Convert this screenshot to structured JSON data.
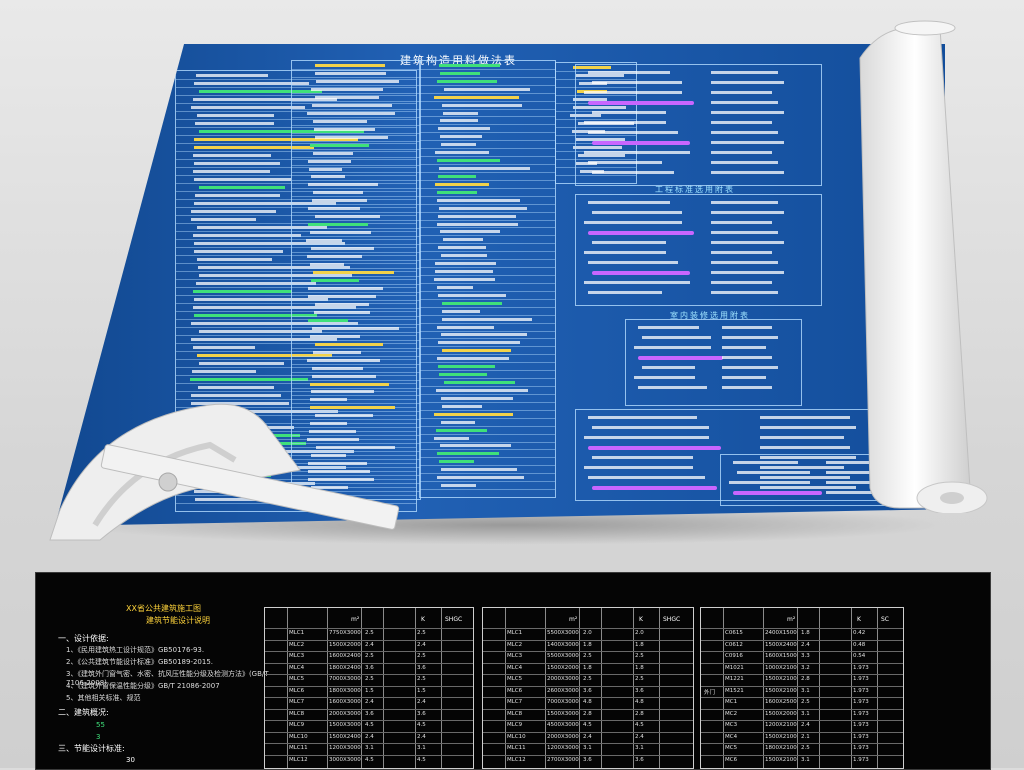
{
  "blueprint": {
    "title": "建筑构造用料做法表",
    "section2_title": "工程标准选用附表",
    "section3_title": "室内装修选用附表"
  },
  "cad": {
    "title_line1": "XX省公共建筑施工图",
    "title_line2": "建筑节能设计说明",
    "section1": "一、设计依据:",
    "requirements": [
      "1、《民用建筑热工设计规范》GB50176-93.",
      "2、《公共建筑节能设计标准》GB50189-2015.",
      "3、《建筑外门窗气密、水密、抗风压性能分级及检测方法》(GB/T 7106-2008)",
      "4、《建筑外窗保温性能分级》GB/T 21086-2007",
      "5、其他相关标准、规范"
    ],
    "section2": "二、建筑概况:",
    "section3": "三、节能设计标准:",
    "numbers": [
      "55",
      "3",
      "30"
    ],
    "table_units": [
      "K",
      "SHGC",
      "SC",
      "m²"
    ],
    "table1_codes": [
      "MLC1",
      "MLC2",
      "MLC3",
      "MLC4",
      "MLC5",
      "MLC6",
      "MLC7",
      "MLC8",
      "MLC9",
      "MLC10",
      "MLC11",
      "MLC12"
    ],
    "table1_sizes": [
      "7750X3000",
      "1500X2000",
      "1600X2400",
      "1800X2400",
      "7000X3000",
      "1800X3000",
      "1600X3000",
      "2000X3000",
      "1500X3000",
      "1500X2400",
      "1200X3000",
      "3000X3000"
    ],
    "table1_vals": [
      "2.5",
      "2.4",
      "2.5",
      "3.6",
      "2.5",
      "1.5",
      "2.4",
      "3.6",
      "4.5",
      "2.4",
      "3.1",
      "4.5"
    ],
    "table2_codes": [
      "MLC1",
      "MLC2",
      "MLC3",
      "MLC4",
      "MLC5",
      "MLC6",
      "MLC7",
      "MLC8",
      "MLC9",
      "MLC10",
      "MLC11",
      "MLC12"
    ],
    "table2_sizes": [
      "5500X3000",
      "1400X3000",
      "5500X3000",
      "1500X2000",
      "2000X3000",
      "2600X3000",
      "7000X3000",
      "1500X3000",
      "4500X3000",
      "2000X3000",
      "1200X3000",
      "2700X3000"
    ],
    "table2_vals": [
      "2.0",
      "1.8",
      "2.5",
      "1.8",
      "2.5",
      "3.6",
      "4.8",
      "2.8",
      "4.5",
      "2.4",
      "3.1",
      "3.6"
    ],
    "table3_codes": [
      "C0615",
      "C0612",
      "C0916",
      "M1021",
      "M1221",
      "M1521",
      "MC1",
      "MC2",
      "MC3",
      "MC4",
      "MC5",
      "MC6"
    ],
    "table3_sizes": [
      "2400X1500",
      "1500X2400",
      "1600X1500",
      "1000X2100",
      "1500X2100",
      "1500X2100",
      "1600X2500",
      "1500X2000",
      "1200X2100",
      "1500X2100",
      "1800X2100",
      "1500X2100"
    ],
    "table3_vals": [
      "1.8",
      "2.4",
      "3.3",
      "3.2",
      "2.8",
      "3.1",
      "2.5",
      "3.1",
      "2.4",
      "2.1",
      "2.5",
      "3.1"
    ],
    "table3_k": [
      "0.42",
      "0.48",
      "0.54",
      "1.973",
      "1.973",
      "1.973",
      "1.973",
      "1.973",
      "1.973",
      "1.973",
      "1.973",
      "1.973"
    ],
    "door_label": "外门"
  },
  "colors": {
    "sheet": "#1558b0",
    "cad_bg": "#050505",
    "cad_title": "#ffd43b"
  }
}
